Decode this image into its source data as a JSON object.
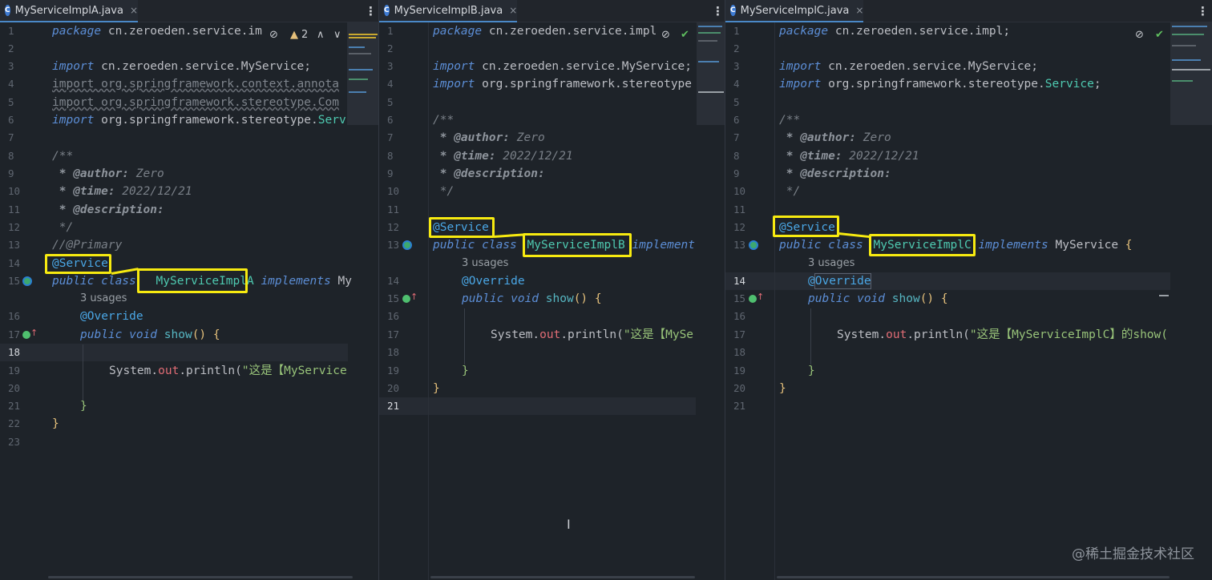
{
  "tabs": [
    {
      "name": "MyServiceImplA.java",
      "close": "×"
    },
    {
      "name": "MyServiceImplB.java",
      "close": "×"
    },
    {
      "name": "MyServiceImplC.java",
      "close": "×"
    }
  ],
  "file_icon_letter": "C",
  "tab_menu": "⋮",
  "inspection_warning_count": "2",
  "pane_a": {
    "lines": [
      "1",
      "2",
      "3",
      "4",
      "5",
      "6",
      "7",
      "8",
      "9",
      "10",
      "11",
      "12",
      "13",
      "14",
      "15",
      "16",
      "17",
      "18",
      "19",
      "20",
      "21",
      "22",
      "23"
    ],
    "current_line": "18",
    "pkg_kw": "package",
    "pkg_name": " cn.zeroeden.service.im",
    "import_kw": "import",
    "imp1": " cn.zeroeden.service.MyService;",
    "imp2": "import org.springframework.context.annota",
    "imp3": "import org.springframework.stereotype.Com",
    "imp4a": " org.springframework.stereotype.",
    "imp4b": "Serv",
    "doc_open": "/**",
    "doc_author_tag": " * @author:",
    "doc_author": " Zero",
    "doc_time_tag": " * @time:",
    "doc_time": " 2022/12/21",
    "doc_desc_tag": " * @description:",
    "doc_close": " */",
    "primary_comment": "//@Primary",
    "service_ann": "@Service",
    "class_decl_kw": "public class ",
    "class_name": "MyServiceImplA",
    "implements_kw": " implements ",
    "iface": "My",
    "usages": "3 usages",
    "override": "@Override",
    "method_kw": "public void ",
    "method_name": "show",
    "method_rest": "() {",
    "sys": "System.",
    "out": "out",
    "println": ".println(",
    "str": "\"这是【MyService",
    "close_brace": "}"
  },
  "pane_b": {
    "lines": [
      "1",
      "2",
      "3",
      "4",
      "5",
      "6",
      "7",
      "8",
      "9",
      "10",
      "11",
      "12",
      "13",
      "14",
      "15",
      "16",
      "17",
      "18",
      "19",
      "20",
      "21"
    ],
    "current_line": "21",
    "pkg_name": " cn.zeroeden.service.impl",
    "imp1": " cn.zeroeden.service.MyService;",
    "imp2a": " org.springframework.stereotype",
    "class_name": "MyServiceImplB",
    "implements_kw": " implement",
    "str": "\"这是【MySe"
  },
  "pane_c": {
    "lines": [
      "1",
      "2",
      "3",
      "4",
      "5",
      "6",
      "7",
      "8",
      "9",
      "10",
      "11",
      "12",
      "13",
      "14",
      "15",
      "16",
      "17",
      "18",
      "19",
      "20",
      "21"
    ],
    "current_line": "14",
    "pkg_name": " cn.zeroeden.service.impl;",
    "imp1": " cn.zeroeden.service.MyService;",
    "imp2a": " org.springframework.stereotype.",
    "imp2b": "Service",
    "imp2c": ";",
    "class_name": "MyServiceImplC",
    "implements_kw": " implements ",
    "iface": "MyService",
    "iface_brace": " {",
    "str": "\"这是【MyServiceImplC】的show("
  },
  "watermark": "@稀土掘金技术社区",
  "text_cursor": "I",
  "colors": {
    "highlight": "#f7ea10",
    "background": "#1e2329",
    "keyword": "#5c8ed6",
    "annotation": "#4aa7e6"
  },
  "icons": [
    "eye-slash-icon",
    "warning-icon",
    "check-icon",
    "chevron-up-icon",
    "chevron-down-icon",
    "bean-gutter-icon",
    "override-gutter-icon"
  ]
}
